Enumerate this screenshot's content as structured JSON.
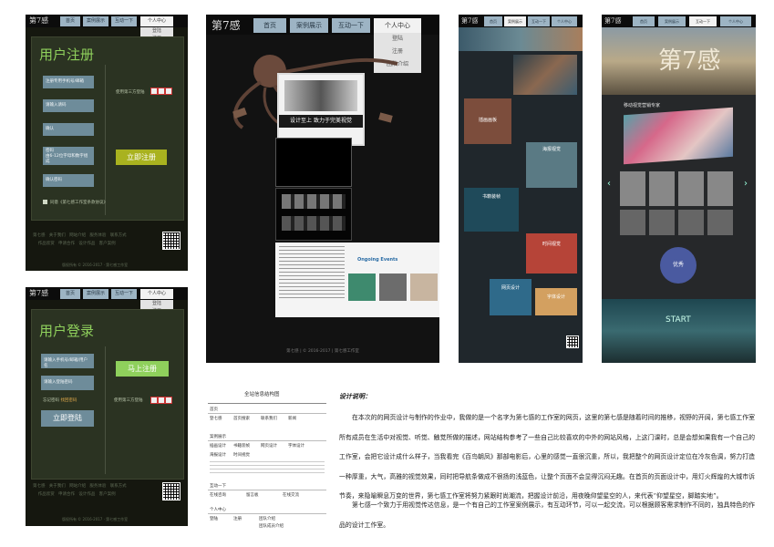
{
  "nav": {
    "logo": "第7感",
    "tabs": [
      "首页",
      "案例展示",
      "互动一下",
      "个人中心"
    ],
    "dropdown": [
      "登陆",
      "注册",
      "团队介绍"
    ]
  },
  "register": {
    "title": "用户注册",
    "fields": [
      "注册专用手机号/邮箱",
      "请输入请码",
      "确认",
      "密码",
      "确认密码"
    ],
    "password_hint": "由6-12位字母和数字组成",
    "third_party": "使用第三方登陆",
    "agree": "同意《第七感工作室条款协议》",
    "submit": "立即注册"
  },
  "login": {
    "title": "用户登录",
    "fields": [
      "请输入手机号/邮箱/用户名",
      "请输入登陆密码"
    ],
    "forgot_prefix": "忘记密码",
    "forgot_link": "找回密码",
    "submit": "立即登陆",
    "signup": "马上注册",
    "third_party": "使用第三方登陆"
  },
  "footer": {
    "links": [
      "第七感",
      "关于我们",
      "网站介绍",
      "服务体验",
      "联系方式",
      "作品欣赏",
      "申请合作",
      "设计作品",
      "客户案例",
      "设计规划"
    ],
    "copyright": "版权所有 © 2016-2017 · 第七感工作室"
  },
  "home": {
    "banner": "设计至上  致力于完美视觉",
    "news_title": "Ongoing Events",
    "foot": "第七感 |  © 2016-2017 |  第七感工作室"
  },
  "cases": {
    "labels": [
      "插画画板",
      "海报视觉",
      "书籍装帧",
      "时间视觉",
      "网页设计",
      "字体设计"
    ]
  },
  "interact": {
    "heading": "移动视觉营销专家",
    "start": "START",
    "badge": "优秀"
  },
  "sitemap": {
    "title": "全站信息结构图",
    "sections": [
      {
        "name": "首页",
        "items": [
          "登七感",
          "首页搜索",
          "联系我们",
          "新闻"
        ]
      },
      {
        "name": "案例展示",
        "items": [
          "插画设计",
          "书籍装帧",
          "网页设计",
          "字体设计",
          "海报设计",
          "时间视觉"
        ]
      },
      {
        "name": "互动一下",
        "items": [
          "在线咨询",
          "留言板",
          "在线交流"
        ]
      },
      {
        "name": "个人中心",
        "items": [
          "登陆",
          "注册",
          "团队介绍",
          "团队成员介绍"
        ]
      }
    ]
  },
  "description": {
    "heading": "设计说明：",
    "p1": "在本次的的网页设计与制作的作业中，我做的是一个名字为第七感的工作室的网页，这里的第七感是随着时间的推移，视野的开阔，第七感工作室所有成员在生活中对视觉、听觉、触觉所做的描述，网站结构参考了一些自己比较喜欢的中外的网站风格，上这门课时，总是会想如果我有一个自己的工作室，会把它设计成什么样子，当我看完《百鸟朝凤》那部电影后，心里的感觉一直很沉重，所以，我把整个的网页设计定位在冷灰色调，努力打造一种厚重，大气，高雅的视觉效果，同时把导航条做成不很扬的浅蓝色，让整个页面不会显得沉闷无趣。在首页的页面设计中，用灯火辉煌的大城市诉节奏，来隐喻瞬息万变的世界，第七感工作室将努力紧跟时尚潮流，把握设计前沿，用夜晚仰望星空的人，来代表“仰望星空，脚踏实地”。",
    "p2": "第七感一个致力于用视觉传达信息，是一个有自己的工作室案例展示，有互动环节，可以一起交流，可以根据顾客需求制作不同的，独具特色的作品的设计工作室。"
  },
  "colors": {
    "accent_green": "#8fd05c",
    "button_olive": "#a9b21f",
    "nav_blue": "#9db4c4",
    "dark_bg": "#15170f"
  }
}
